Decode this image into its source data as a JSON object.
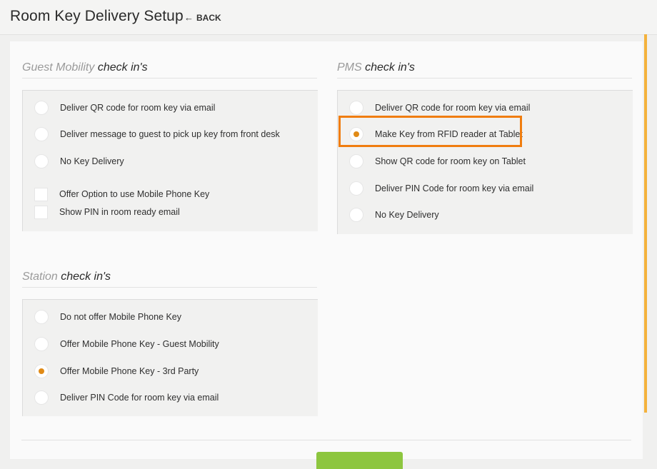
{
  "header": {
    "title": "Room Key Delivery Setup",
    "back_label": "BACK"
  },
  "guest_mobility": {
    "title_light": "Guest Mobility",
    "title_dark": "check in's",
    "options": [
      {
        "label": "Deliver QR code for room key via email",
        "selected": false
      },
      {
        "label": "Deliver message to guest to pick up key from front desk",
        "selected": false
      },
      {
        "label": "No Key Delivery",
        "selected": false
      }
    ],
    "checkboxes": [
      {
        "label": "Offer Option to use Mobile Phone Key",
        "checked": false
      },
      {
        "label": "Show PIN in room ready email",
        "checked": false
      }
    ]
  },
  "pms": {
    "title_light": "PMS",
    "title_dark": "check in's",
    "options": [
      {
        "label": "Deliver QR code for room key via email",
        "selected": false
      },
      {
        "label": "Make Key from RFID reader at Tablet",
        "selected": true
      },
      {
        "label": "Show QR code for room key on Tablet",
        "selected": false
      },
      {
        "label": "Deliver PIN Code for room key via email",
        "selected": false
      },
      {
        "label": "No Key Delivery",
        "selected": false
      }
    ]
  },
  "station": {
    "title_light": "Station",
    "title_dark": "check in's",
    "options": [
      {
        "label": "Do not offer Mobile Phone Key",
        "selected": false
      },
      {
        "label": "Offer Mobile Phone Key - Guest Mobility",
        "selected": false
      },
      {
        "label": "Offer Mobile Phone Key - 3rd Party",
        "selected": true
      },
      {
        "label": "Deliver PIN Code for room key via email",
        "selected": false
      }
    ]
  },
  "colors": {
    "accent_orange": "#e08a16",
    "highlight_orange": "#f07d0f",
    "save_green": "#8dc63f",
    "scroll_accent": "#f4b23c"
  }
}
